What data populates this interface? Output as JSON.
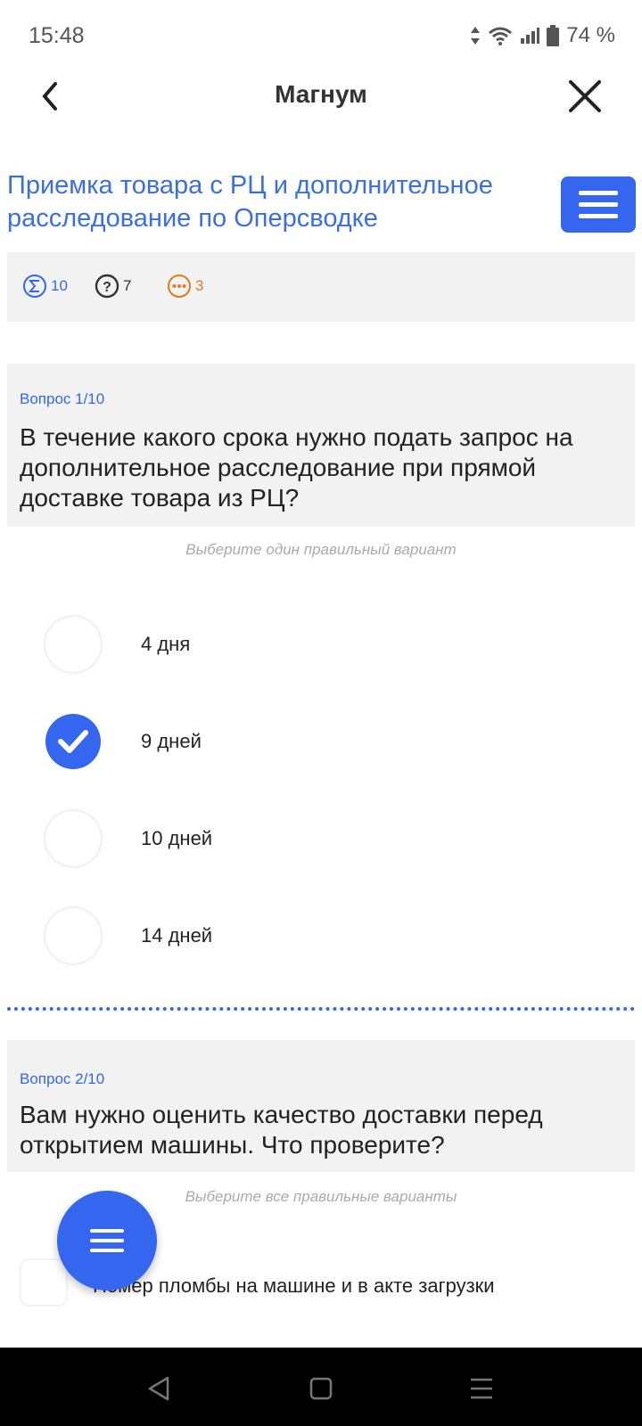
{
  "status_bar": {
    "time": "15:48",
    "battery": "74 %",
    "icons": [
      "data-arrows-icon",
      "wifi-icon",
      "signal-icon",
      "battery-icon"
    ]
  },
  "app_bar": {
    "title": "Магнум",
    "back_icon": "chevron-left-icon",
    "close_icon": "close-icon"
  },
  "course": {
    "title": "Приемка товара с РЦ и дополнительное расследование по Оперсводке",
    "menu_icon": "hamburger-icon"
  },
  "stats": {
    "total": "10",
    "questions": "7",
    "other": "3"
  },
  "question1": {
    "number": "Вопрос 1/10",
    "text": "В течение какого срока нужно подать запрос на дополнительное расследование при прямой доставке товара из РЦ?",
    "hint": "Выберите один правильный вариант",
    "options": [
      {
        "label": "4 дня",
        "selected": false
      },
      {
        "label": "9 дней",
        "selected": true
      },
      {
        "label": "10 дней",
        "selected": false
      },
      {
        "label": "14 дней",
        "selected": false
      }
    ]
  },
  "question2": {
    "number": "Вопрос 2/10",
    "text": "Вам нужно оценить качество доставки перед открытием машины. Что проверите?",
    "hint": "Выберите все правильные варианты",
    "options": [
      {
        "label": "Номер пломбы на машине и в акте загрузки",
        "checked": false
      }
    ]
  },
  "colors": {
    "accent": "#3466ef",
    "orange": "#e07a1f",
    "panel": "#f2f2f2"
  }
}
